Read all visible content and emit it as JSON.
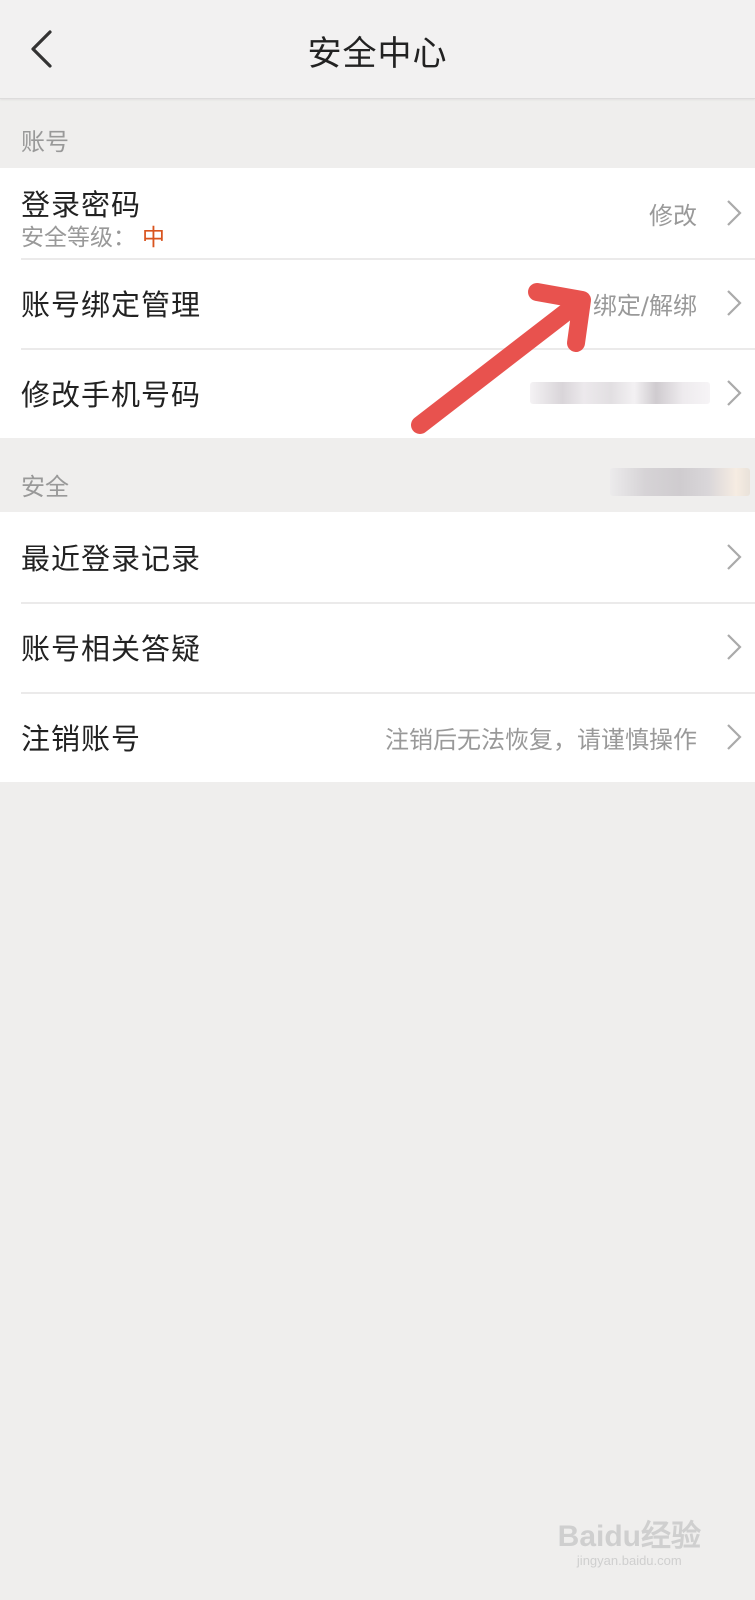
{
  "header": {
    "title": "安全中心"
  },
  "sections": {
    "account_label": "账号",
    "security_label": "安全"
  },
  "account": {
    "password": {
      "label": "登录密码",
      "level_prefix": "安全等级：",
      "level_value": "中",
      "action": "修改"
    },
    "binding": {
      "label": "账号绑定管理",
      "value": "绑定/解绑"
    },
    "phone": {
      "label": "修改手机号码"
    }
  },
  "security": {
    "recent_login": {
      "label": "最近登录记录"
    },
    "faq": {
      "label": "账号相关答疑"
    },
    "cancel": {
      "label": "注销账号",
      "value": "注销后无法恢复，请谨慎操作"
    }
  },
  "watermark": {
    "main": "Baidu经验",
    "sub": "jingyan.baidu.com"
  },
  "colors": {
    "accent_level": "#d9541e",
    "annotation_arrow": "#e8524e"
  }
}
